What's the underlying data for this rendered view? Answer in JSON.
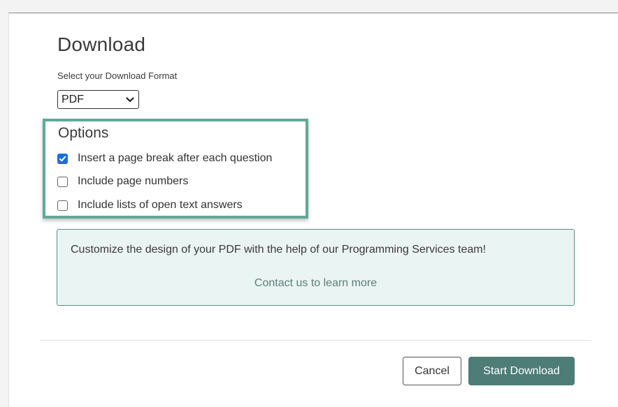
{
  "dialog": {
    "title": "Download",
    "format_label": "Select your Download Format",
    "format_select": {
      "selected": "PDF"
    },
    "options": {
      "title": "Options",
      "items": [
        {
          "label": "Insert a page break after each question",
          "checked": true
        },
        {
          "label": "Include page numbers",
          "checked": false
        },
        {
          "label": "Include lists of open text answers",
          "checked": false
        }
      ]
    },
    "promo": {
      "text": "Customize the design of your PDF with the help of our Programming Services team!",
      "link": "Contact us to learn more"
    },
    "buttons": {
      "cancel": "Cancel",
      "start": "Start Download"
    }
  },
  "colors": {
    "accent": "#4d7d76",
    "highlight_border": "#5fab98",
    "checkbox_checked": "#1a6fde",
    "promo_bg": "#eaf4f2"
  },
  "icons": {
    "select_chevron": "chevron-down-icon",
    "checkbox_check": "check-icon"
  }
}
